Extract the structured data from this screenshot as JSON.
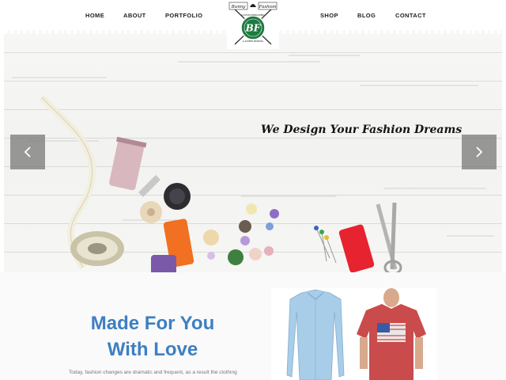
{
  "nav": {
    "left_links": [
      "HOME",
      "ABOUT",
      "PORTFOLIO"
    ],
    "right_links": [
      "SHOP",
      "BLOG",
      "CONTACT"
    ]
  },
  "logo": {
    "top_left_text": "Bunny",
    "top_right_text": "Fashion",
    "monogram": "BF",
    "ribbon_top": "CUSTOM EMBROIDERY",
    "ribbon_bottom": "& SCREEN PRINTING",
    "accent_color": "#1e7a40"
  },
  "hero": {
    "tagline": "We Design Your Fashion Dreams",
    "prev_icon": "chevron-left-icon",
    "next_icon": "chevron-right-icon"
  },
  "intro": {
    "headline_line1": "Made For You",
    "headline_line2": "With Love",
    "body": "Today, fashion changes are dramatic and frequent, as a result the clothing",
    "headline_color": "#3d7fc2"
  }
}
